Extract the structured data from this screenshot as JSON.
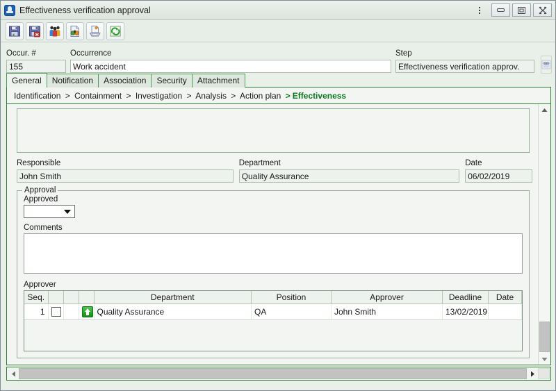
{
  "window": {
    "title": "Effectiveness verification approval",
    "icon": "app-icon",
    "menu_icon": "kebab-menu-icon",
    "minimize_label": "Minimize",
    "maximize_label": "Maximize",
    "close_label": "Close"
  },
  "toolbar": {
    "buttons": [
      {
        "name": "save-button",
        "icon": "floppy-disk-icon",
        "label": "Save"
      },
      {
        "name": "save-and-close-button",
        "icon": "floppy-disk-delete-icon",
        "label": "Delete"
      },
      {
        "name": "team-button",
        "icon": "people-group-icon",
        "label": "Team"
      },
      {
        "name": "search-record-button",
        "icon": "document-binoculars-icon",
        "label": "Find"
      },
      {
        "name": "print-button",
        "icon": "printer-document-icon",
        "label": "Print"
      },
      {
        "name": "refresh-button",
        "icon": "refresh-arrows-icon",
        "label": "Refresh"
      }
    ]
  },
  "header": {
    "occurrence_number_label": "Occur. #",
    "occurrence_number_value": "155",
    "occurrence_label": "Occurrence",
    "occurrence_value": "Work accident",
    "step_label": "Step",
    "step_value": "Effectiveness verification approv.",
    "step_search_icon": "binoculars-icon"
  },
  "tabs": [
    {
      "label": "General",
      "active": true
    },
    {
      "label": "Notification",
      "active": false
    },
    {
      "label": "Association",
      "active": false
    },
    {
      "label": "Security",
      "active": false
    },
    {
      "label": "Attachment",
      "active": false
    }
  ],
  "breadcrumb": {
    "items": [
      "Identification",
      "Containment",
      "Investigation",
      "Analysis",
      "Action plan"
    ],
    "current": "Effectiveness",
    "separator": ">"
  },
  "form": {
    "description_value": "",
    "responsible_label": "Responsible",
    "responsible_value": "John Smith",
    "department_label": "Department",
    "department_value": "Quality Assurance",
    "date_label": "Date",
    "date_value": "06/02/2019"
  },
  "approval": {
    "legend": "Approval",
    "approved_label": "Approved",
    "approved_value": "",
    "approved_placeholder": "",
    "comments_label": "Comments",
    "comments_value": ""
  },
  "approver": {
    "label": "Approver",
    "columns": [
      "Seq.",
      "",
      "",
      "",
      "Department",
      "Position",
      "Approver",
      "Deadline",
      "Date"
    ],
    "rows": [
      {
        "seq": "1",
        "checked": false,
        "status_icon": "green-up-arrow-icon",
        "department": "Quality Assurance",
        "position": "QA",
        "approver": "John Smith",
        "deadline": "13/02/2019",
        "date": ""
      }
    ]
  },
  "scrollbars": {
    "vertical_up_icon": "triangle-up-icon",
    "vertical_down_icon": "triangle-down-icon",
    "horizontal_left_icon": "triangle-left-icon",
    "horizontal_right_icon": "triangle-right-icon"
  },
  "colors": {
    "accent_green": "#2e7d32",
    "current_step_green": "#0a7a1e",
    "window_background": "#e9efe9",
    "panel_background": "#f2f5f2",
    "field_background": "#eef2ee"
  }
}
